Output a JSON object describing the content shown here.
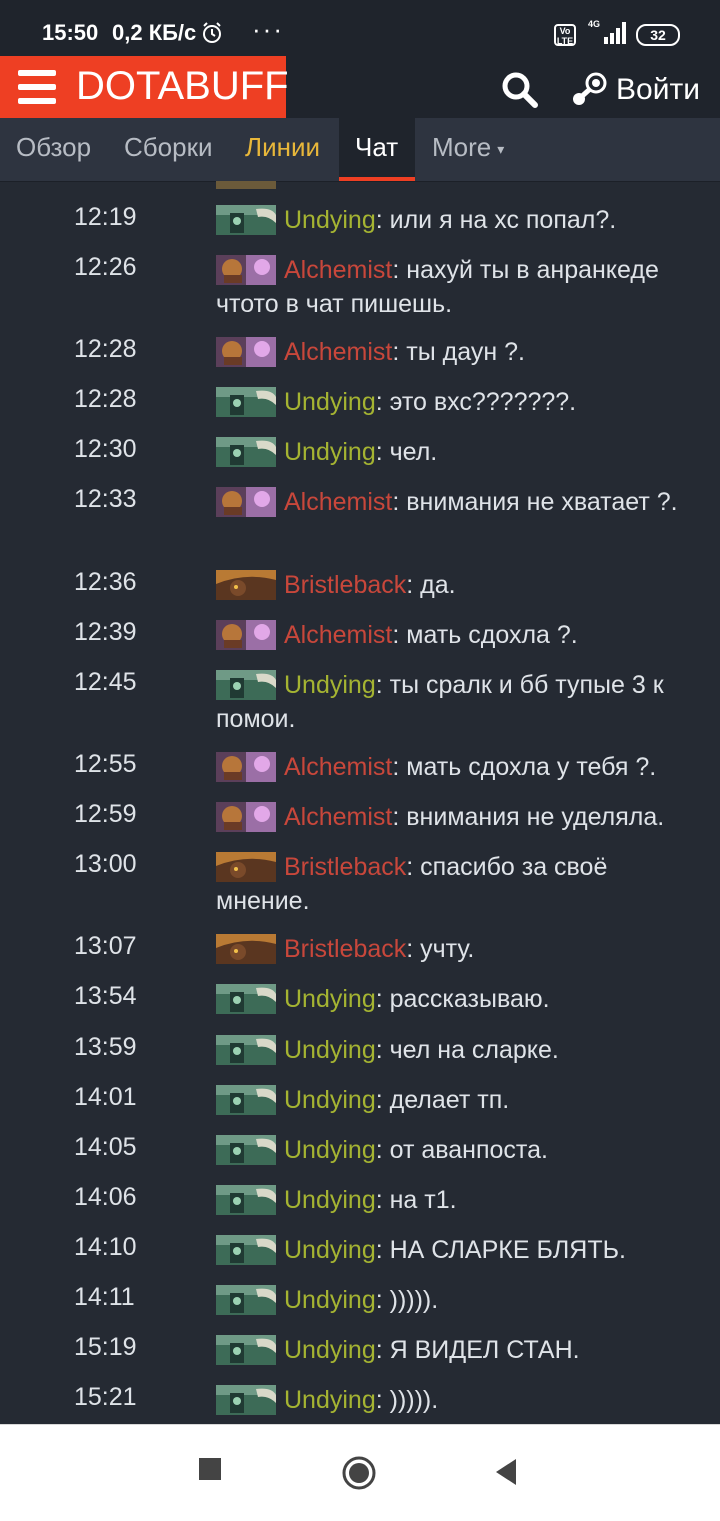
{
  "status_bar": {
    "time": "15:50",
    "speed": "0,2 КБ/с",
    "overflow": "···",
    "network": "4G",
    "volte": "Vo LTE",
    "battery": "32"
  },
  "header": {
    "logo_text": "DOTABUFF",
    "login_label": "Войти",
    "icons": [
      "hamburger-menu-icon",
      "search-icon",
      "steam-icon"
    ]
  },
  "nav": {
    "tabs": [
      {
        "label": "Обзор",
        "state": "normal"
      },
      {
        "label": "Сборки",
        "state": "normal"
      },
      {
        "label": "Линии",
        "state": "highlighted"
      },
      {
        "label": "Чат",
        "state": "active"
      },
      {
        "label": "More",
        "state": "dropdown"
      }
    ],
    "more_caret": "▾"
  },
  "colors": {
    "brand": "#ee3f23",
    "undying": "#a5b432",
    "alchemist": "#c8473b",
    "bristleback": "#c8473b",
    "lanes_tab": "#e8b73a"
  },
  "chat": {
    "messages": [
      {
        "time": "12:19",
        "hero": "Undying",
        "text": ": или я на хс попал?."
      },
      {
        "time": "12:26",
        "hero": "Alchemist",
        "text": ": нахуй ты в анранкеде чтото в чат пишешь."
      },
      {
        "time": "12:28",
        "hero": "Alchemist",
        "text": ": ты даун ?."
      },
      {
        "time": "12:28",
        "hero": "Undying",
        "text": ": это вхс???????."
      },
      {
        "time": "12:30",
        "hero": "Undying",
        "text": ": чел."
      },
      {
        "time": "12:33",
        "hero": "Alchemist",
        "text": ": внимания не хватает ?."
      },
      {
        "time": "12:36",
        "hero": "Bristleback",
        "text": ": да."
      },
      {
        "time": "12:39",
        "hero": "Alchemist",
        "text": ": мать сдохла ?."
      },
      {
        "time": "12:45",
        "hero": "Undying",
        "text": ": ты сралк и бб тупые 3 к помои."
      },
      {
        "time": "12:55",
        "hero": "Alchemist",
        "text": ": мать сдохла у тебя ?."
      },
      {
        "time": "12:59",
        "hero": "Alchemist",
        "text": ": внимания не уделяла."
      },
      {
        "time": "13:00",
        "hero": "Bristleback",
        "text": ": спасибо за своё мнение."
      },
      {
        "time": "13:07",
        "hero": "Bristleback",
        "text": ": учту."
      },
      {
        "time": "13:54",
        "hero": "Undying",
        "text": ": рассказываю."
      },
      {
        "time": "13:59",
        "hero": "Undying",
        "text": ": чел на сларке."
      },
      {
        "time": "14:01",
        "hero": "Undying",
        "text": ": делает тп."
      },
      {
        "time": "14:05",
        "hero": "Undying",
        "text": ": от аванпоста."
      },
      {
        "time": "14:06",
        "hero": "Undying",
        "text": ": на т1."
      },
      {
        "time": "14:10",
        "hero": "Undying",
        "text": ": НА СЛАРКЕ БЛЯТЬ."
      },
      {
        "time": "14:11",
        "hero": "Undying",
        "text": ": )))))."
      },
      {
        "time": "15:19",
        "hero": "Undying",
        "text": ": Я ВИДЕЛ СТАН."
      },
      {
        "time": "15:21",
        "hero": "Undying",
        "text": ": )))))."
      }
    ]
  },
  "system_nav": {
    "icons": [
      "recent-apps-icon",
      "home-icon",
      "back-icon"
    ]
  }
}
